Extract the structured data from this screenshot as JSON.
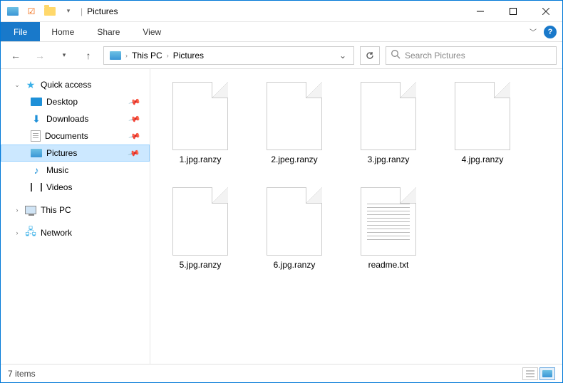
{
  "title": "Pictures",
  "tabs": {
    "file": "File",
    "home": "Home",
    "share": "Share",
    "view": "View"
  },
  "breadcrumb": {
    "root": "This PC",
    "current": "Pictures"
  },
  "search": {
    "placeholder": "Search Pictures"
  },
  "nav": {
    "quick_access": "Quick access",
    "desktop": "Desktop",
    "downloads": "Downloads",
    "documents": "Documents",
    "pictures": "Pictures",
    "music": "Music",
    "videos": "Videos",
    "this_pc": "This PC",
    "network": "Network"
  },
  "files": [
    {
      "name": "1.jpg.ranzy",
      "type": "blank"
    },
    {
      "name": "2.jpeg.ranzy",
      "type": "blank"
    },
    {
      "name": "3.jpg.ranzy",
      "type": "blank"
    },
    {
      "name": "4.jpg.ranzy",
      "type": "blank"
    },
    {
      "name": "5.jpg.ranzy",
      "type": "blank"
    },
    {
      "name": "6.jpg.ranzy",
      "type": "blank"
    },
    {
      "name": "readme.txt",
      "type": "text"
    }
  ],
  "status": {
    "count": "7 items"
  }
}
